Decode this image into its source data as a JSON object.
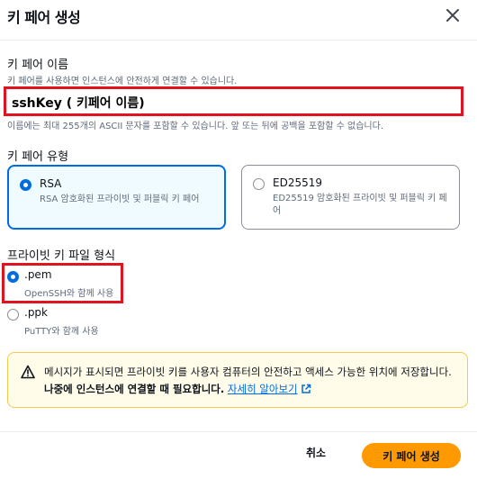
{
  "modal": {
    "title": "키 페어 생성",
    "close_icon": "close-icon"
  },
  "key_name": {
    "label": "키 페어 이름",
    "description": "키 페어를 사용하면 인스턴스에 안전하게 연결할 수 있습니다.",
    "value": "sshKey ( 키페어 이름)",
    "hint": "이름에는 최대 255개의 ASCII 문자를 포함할 수 있습니다. 앞 또는 뒤에 공백을 포함할 수 없습니다."
  },
  "key_type": {
    "label": "키 페어 유형",
    "options": [
      {
        "name": "RSA",
        "description": "RSA 암호화된 프라이빗 및 퍼블릭 키 페어",
        "selected": true
      },
      {
        "name": "ED25519",
        "description": "ED25519 암호화된 프라이빗 및 퍼블릭 키 페어",
        "selected": false
      }
    ]
  },
  "file_format": {
    "label": "프라이빗 키 파일 형식",
    "options": [
      {
        "name": ".pem",
        "description": "OpenSSH와 함께 사용",
        "selected": true
      },
      {
        "name": ".ppk",
        "description": "PuTTY와 함께 사용",
        "selected": false
      }
    ]
  },
  "alert": {
    "icon": "warning-icon",
    "text_line": "메시지가 표시되면 프라이빗 키를 사용자 컴퓨터의 안전하고 액세스 가능한 위치에 저장합니다. ",
    "text_bold": "나중에 인스턴스에 연결할 때 필요합니다.",
    "link": "자세히 알아보기"
  },
  "footer": {
    "cancel_label": "취소",
    "create_label": "키 페어 생성"
  },
  "colors": {
    "accent": "#006ce0",
    "primary_button": "#ff9900",
    "highlight_box": "#e0141e",
    "alert_border": "#f2c94c",
    "alert_background": "#fffce9"
  }
}
